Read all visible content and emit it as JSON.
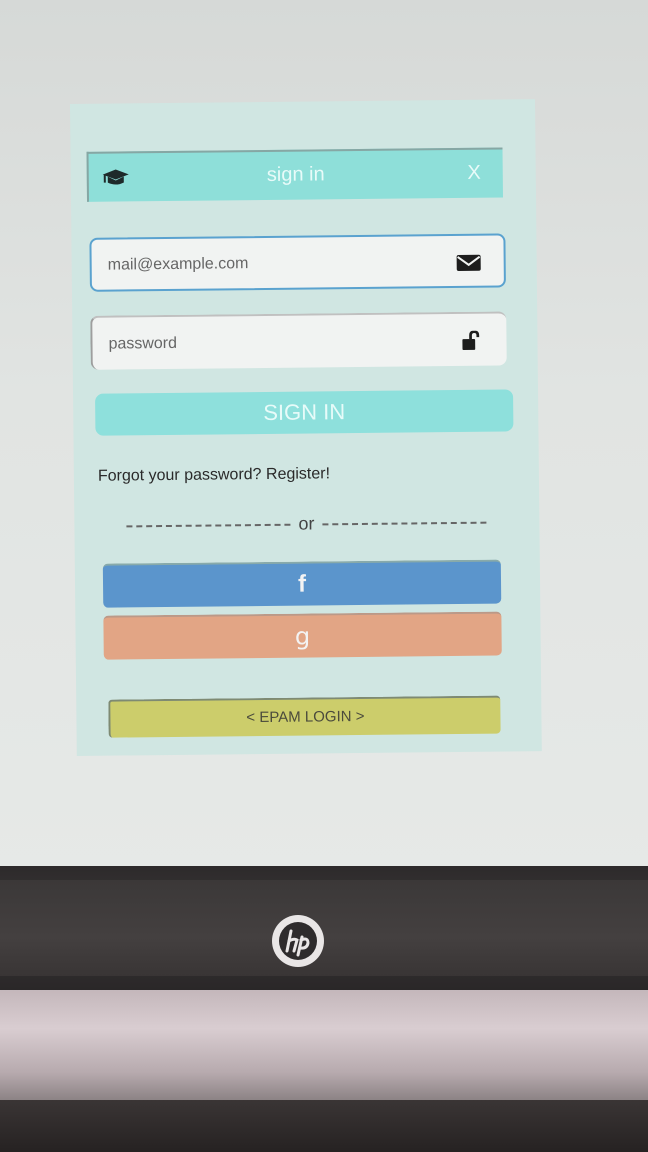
{
  "dialog": {
    "title": "sign in",
    "close_label": "X",
    "header_icon": "graduation-cap-icon"
  },
  "form": {
    "email_placeholder": "mail@example.com",
    "email_icon": "envelope-icon",
    "password_placeholder": "password",
    "password_icon": "unlock-icon",
    "signin_label": "SIGN IN",
    "forgot_label": "Forgot your password?",
    "register_label": "Register!",
    "divider_label": "or"
  },
  "social": {
    "facebook_label": "f",
    "google_label": "g",
    "epam_label": "< EPAM LOGIN >"
  },
  "colors": {
    "panel_bg": "#d0e6e2",
    "header_bg": "#8edfd9",
    "signin_bg": "#8ee0dc",
    "facebook_bg": "#5b95cc",
    "google_bg": "#e2a585",
    "epam_bg": "#cccd6b"
  }
}
